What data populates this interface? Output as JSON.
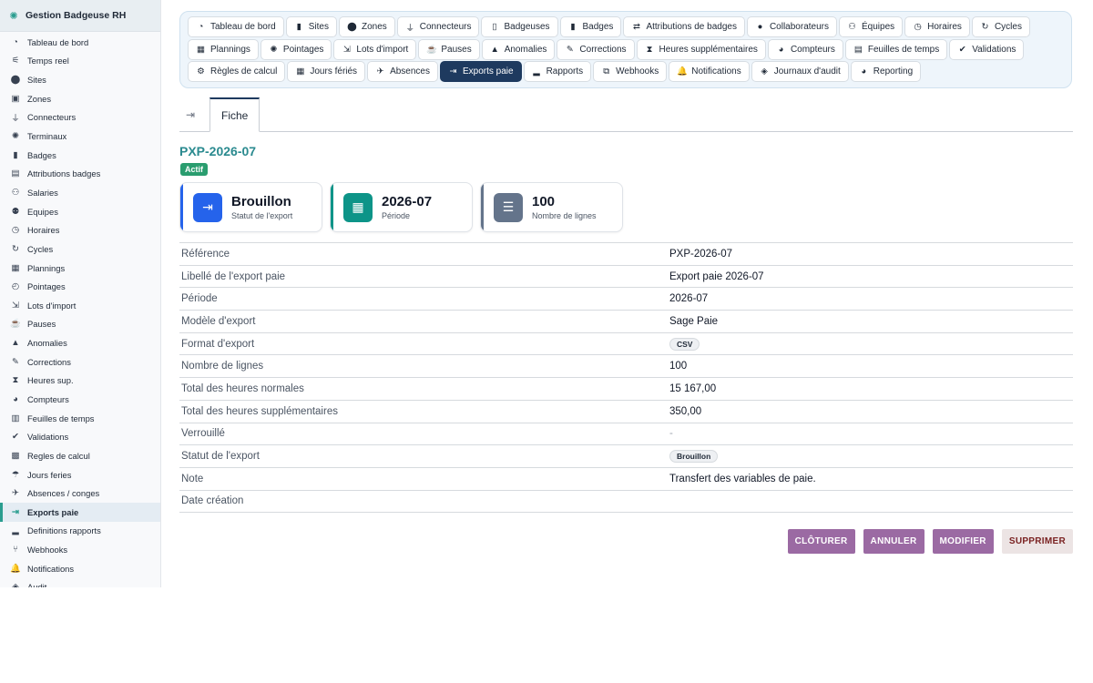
{
  "app": {
    "title": "Gestion Badgeuse RH",
    "icon": "brain-icon"
  },
  "sidebar": {
    "items": [
      {
        "label": "Tableau de bord",
        "icon": "gauge-icon",
        "glyph": "◔"
      },
      {
        "label": "Temps reel",
        "icon": "satellite-icon",
        "glyph": "⚟"
      },
      {
        "label": "Sites",
        "icon": "map-pin-icon",
        "glyph": "⬤"
      },
      {
        "label": "Zones",
        "icon": "vector-square-icon",
        "glyph": "▣"
      },
      {
        "label": "Connecteurs",
        "icon": "plug-icon",
        "glyph": "⏚"
      },
      {
        "label": "Terminaux",
        "icon": "fingerprint-icon",
        "glyph": "✺"
      },
      {
        "label": "Badges",
        "icon": "id-badge-icon",
        "glyph": "▮"
      },
      {
        "label": "Attributions badges",
        "icon": "id-card-icon",
        "glyph": "▤"
      },
      {
        "label": "Salaries",
        "icon": "users-icon",
        "glyph": "⚇"
      },
      {
        "label": "Equipes",
        "icon": "user-group-icon",
        "glyph": "⚉"
      },
      {
        "label": "Horaires",
        "icon": "clock-icon",
        "glyph": "◷"
      },
      {
        "label": "Cycles",
        "icon": "rotate-icon",
        "glyph": "↻"
      },
      {
        "label": "Plannings",
        "icon": "calendar-icon",
        "glyph": "▦"
      },
      {
        "label": "Pointages",
        "icon": "stopwatch-icon",
        "glyph": "◴"
      },
      {
        "label": "Lots d'import",
        "icon": "file-import-icon",
        "glyph": "⇲"
      },
      {
        "label": "Pauses",
        "icon": "mug-icon",
        "glyph": "☕"
      },
      {
        "label": "Anomalies",
        "icon": "warning-icon",
        "glyph": "▲"
      },
      {
        "label": "Corrections",
        "icon": "edit-icon",
        "glyph": "✎"
      },
      {
        "label": "Heures sup.",
        "icon": "hourglass-icon",
        "glyph": "⧗"
      },
      {
        "label": "Compteurs",
        "icon": "gauge-high-icon",
        "glyph": "◕"
      },
      {
        "label": "Feuilles de temps",
        "icon": "file-calendar-icon",
        "glyph": "▥"
      },
      {
        "label": "Validations",
        "icon": "check-double-icon",
        "glyph": "✔"
      },
      {
        "label": "Regles de calcul",
        "icon": "calculator-icon",
        "glyph": "▩"
      },
      {
        "label": "Jours feries",
        "icon": "umbrella-beach-icon",
        "glyph": "☂"
      },
      {
        "label": "Absences / conges",
        "icon": "plane-departure-icon",
        "glyph": "✈"
      },
      {
        "label": "Exports paie",
        "icon": "file-export-icon",
        "glyph": "⇥",
        "active": true
      },
      {
        "label": "Definitions rapports",
        "icon": "chart-bar-icon",
        "glyph": "▂"
      },
      {
        "label": "Webhooks",
        "icon": "code-branch-icon",
        "glyph": "⑂"
      },
      {
        "label": "Notifications",
        "icon": "bell-icon",
        "glyph": "🔔"
      },
      {
        "label": "Audit",
        "icon": "shield-icon",
        "glyph": "◈"
      }
    ]
  },
  "topnav": {
    "tabs": [
      {
        "label": "Tableau de bord",
        "icon": "gauge-icon",
        "glyph": "◔"
      },
      {
        "label": "Sites",
        "icon": "building-icon",
        "glyph": "▮"
      },
      {
        "label": "Zones",
        "icon": "map-pin-icon",
        "glyph": "⬤"
      },
      {
        "label": "Connecteurs",
        "icon": "plug-icon",
        "glyph": "⏚"
      },
      {
        "label": "Badgeuses",
        "icon": "tablet-icon",
        "glyph": "▯"
      },
      {
        "label": "Badges",
        "icon": "id-badge-icon",
        "glyph": "▮"
      },
      {
        "label": "Attributions de badges",
        "icon": "exchange-icon",
        "glyph": "⇄"
      },
      {
        "label": "Collaborateurs",
        "icon": "user-icon",
        "glyph": "●"
      },
      {
        "label": "Équipes",
        "icon": "users-icon",
        "glyph": "⚇"
      },
      {
        "label": "Horaires",
        "icon": "clock-icon",
        "glyph": "◷"
      },
      {
        "label": "Cycles",
        "icon": "rotate-icon",
        "glyph": "↻"
      },
      {
        "label": "Plannings",
        "icon": "calendar-icon",
        "glyph": "▦"
      },
      {
        "label": "Pointages",
        "icon": "fingerprint-icon",
        "glyph": "✺"
      },
      {
        "label": "Lots d'import",
        "icon": "file-import-icon",
        "glyph": "⇲"
      },
      {
        "label": "Pauses",
        "icon": "mug-icon",
        "glyph": "☕"
      },
      {
        "label": "Anomalies",
        "icon": "warning-icon",
        "glyph": "▲"
      },
      {
        "label": "Corrections",
        "icon": "edit-icon",
        "glyph": "✎"
      },
      {
        "label": "Heures supplémentaires",
        "icon": "hourglass-icon",
        "glyph": "⧗"
      },
      {
        "label": "Compteurs",
        "icon": "gauge-high-icon",
        "glyph": "◕"
      },
      {
        "label": "Feuilles de temps",
        "icon": "table-icon",
        "glyph": "▤"
      },
      {
        "label": "Validations",
        "icon": "check-double-icon",
        "glyph": "✔"
      },
      {
        "label": "Règles de calcul",
        "icon": "gears-icon",
        "glyph": "⚙"
      },
      {
        "label": "Jours fériés",
        "icon": "calendar-day-icon",
        "glyph": "▦"
      },
      {
        "label": "Absences",
        "icon": "plane-departure-icon",
        "glyph": "✈"
      },
      {
        "label": "Exports paie",
        "icon": "file-export-icon",
        "glyph": "⇥",
        "active": true
      },
      {
        "label": "Rapports",
        "icon": "chart-bar-icon",
        "glyph": "▂"
      },
      {
        "label": "Webhooks",
        "icon": "sitemap-icon",
        "glyph": "⧉"
      },
      {
        "label": "Notifications",
        "icon": "bell-icon",
        "glyph": "🔔"
      },
      {
        "label": "Journaux d'audit",
        "icon": "shield-icon",
        "glyph": "◈"
      },
      {
        "label": "Reporting",
        "icon": "chart-pie-icon",
        "glyph": "◕"
      }
    ]
  },
  "subtabs": {
    "icon": "file-export-icon",
    "active_label": "Fiche"
  },
  "record": {
    "title": "PXP-2026-07",
    "status_badge": "Actif"
  },
  "cards": [
    {
      "value": "Brouillon",
      "label": "Statut de l'export",
      "icon": "file-export-icon",
      "glyph": "⇥"
    },
    {
      "value": "2026-07",
      "label": "Période",
      "icon": "calendar-icon",
      "glyph": "▦"
    },
    {
      "value": "100",
      "label": "Nombre de lignes",
      "icon": "list-icon",
      "glyph": "☰"
    }
  ],
  "details": [
    {
      "label": "Référence",
      "value": "PXP-2026-07"
    },
    {
      "label": "Libellé de l'export paie",
      "value": "Export paie 2026-07"
    },
    {
      "label": "Période",
      "value": "2026-07"
    },
    {
      "label": "Modèle d'export",
      "value": "Sage Paie"
    },
    {
      "label": "Format d'export",
      "value": "CSV",
      "pill": true
    },
    {
      "label": "Nombre de lignes",
      "value": "100"
    },
    {
      "label": "Total des heures normales",
      "value": "15 167,00"
    },
    {
      "label": "Total des heures supplémentaires",
      "value": "350,00"
    },
    {
      "label": "Verrouillé",
      "value": "-",
      "muted": true
    },
    {
      "label": "Statut de l'export",
      "value": "Brouillon",
      "pill": true
    },
    {
      "label": "Note",
      "value": "Transfert des variables de paie."
    },
    {
      "label": "Date création",
      "value": ""
    }
  ],
  "actions": {
    "close_label": "CLÔTURER",
    "cancel_label": "ANNULER",
    "edit_label": "MODIFIER",
    "delete_label": "SUPPRIMER"
  },
  "colors": {
    "accent_teal": "#2a9d8f",
    "nav_active": "#1e3a5f",
    "badge_green": "#2a9d6f",
    "action_violet": "#9b6aa3",
    "danger_text": "#7a2222"
  }
}
